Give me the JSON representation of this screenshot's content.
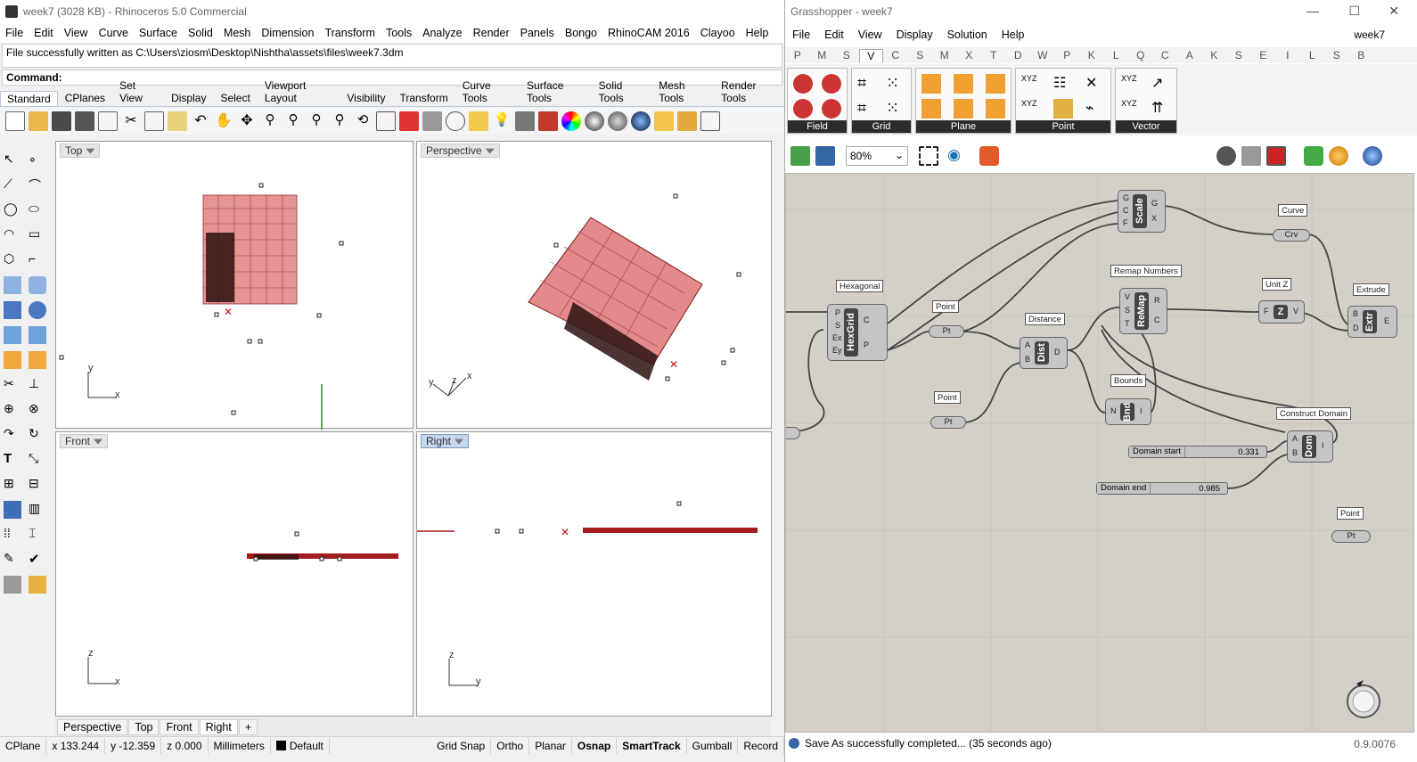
{
  "rhino": {
    "title": "week7 (3028 KB) - Rhinoceros 5.0 Commercial",
    "menu": [
      "File",
      "Edit",
      "View",
      "Curve",
      "Surface",
      "Solid",
      "Mesh",
      "Dimension",
      "Transform",
      "Tools",
      "Analyze",
      "Render",
      "Panels",
      "Bongo",
      "RhinoCAM 2016",
      "Clayoo",
      "Help"
    ],
    "command_history": "File successfully written as C:\\Users\\ziosm\\Desktop\\Nishtha\\assets\\files\\week7.3dm",
    "command_prompt": "Command:",
    "toolbar_tabs": [
      "Standard",
      "CPlanes",
      "Set View",
      "Display",
      "Select",
      "Viewport Layout",
      "Visibility",
      "Transform",
      "Curve Tools",
      "Surface Tools",
      "Solid Tools",
      "Mesh Tools",
      "Render Tools"
    ],
    "viewports": {
      "top": {
        "label": "Top",
        "axis_x": "x",
        "axis_y": "y"
      },
      "perspective": {
        "label": "Perspective",
        "axis_x": "x",
        "axis_y": "y",
        "axis_z": "z"
      },
      "front": {
        "label": "Front",
        "axis_x": "x",
        "axis_y": "z"
      },
      "right": {
        "label": "Right",
        "axis_x": "y",
        "axis_y": "z"
      }
    },
    "viewport_tabs": [
      "Perspective",
      "Top",
      "Front",
      "Right"
    ],
    "add_tab": "+",
    "status": {
      "cplane": "CPlane",
      "x": "x 133.244",
      "y": "y -12.359",
      "z": "z 0.000",
      "units": "Millimeters",
      "layer": "Default",
      "grid_snap": "Grid Snap",
      "ortho": "Ortho",
      "planar": "Planar",
      "osnap": "Osnap",
      "smarttrack": "SmartTrack",
      "gumball": "Gumball",
      "record": "Record"
    }
  },
  "grasshopper": {
    "title": "Grasshopper - week7",
    "menu": [
      "File",
      "Edit",
      "View",
      "Display",
      "Solution",
      "Help"
    ],
    "document": "week7",
    "category_tabs": [
      "P",
      "M",
      "S",
      "V",
      "C",
      "S",
      "M",
      "X",
      "T",
      "D",
      "W",
      "P",
      "K",
      "L",
      "Q",
      "C",
      "A",
      "K",
      "S",
      "E",
      "I",
      "L",
      "S",
      "B"
    ],
    "ribbon_groups": [
      "Field",
      "Grid",
      "Plane",
      "Point",
      "Vector"
    ],
    "zoom": "80%",
    "canvas": {
      "hexgrid": {
        "tag": "Hexagonal",
        "core": "HexGrid",
        "inputs": [
          "P",
          "S",
          "Ex",
          "Ey"
        ],
        "outputs": [
          "C",
          "P"
        ]
      },
      "scale": {
        "core": "Scale",
        "inputs": [
          "G",
          "C",
          "F"
        ],
        "outputs": [
          "G",
          "X"
        ]
      },
      "curve": {
        "tag": "Curve",
        "param": "Crv"
      },
      "point1": {
        "tag": "Point",
        "param": "Pt"
      },
      "point2": {
        "tag": "Point",
        "param": "Pt"
      },
      "point3": {
        "tag": "Point",
        "param": "Pt"
      },
      "distance": {
        "tag": "Distance",
        "core": "Dist",
        "inputs": [
          "A",
          "B"
        ],
        "outputs": [
          "D"
        ]
      },
      "remap": {
        "tag": "Remap Numbers",
        "core": "ReMap",
        "inputs": [
          "V",
          "S",
          "T"
        ],
        "outputs": [
          "R",
          "C"
        ]
      },
      "unitz": {
        "tag": "Unit Z",
        "core": "Z",
        "inputs": [
          "F"
        ],
        "outputs": [
          "V"
        ]
      },
      "extrude": {
        "tag": "Extrude",
        "core": "Extr",
        "inputs": [
          "B",
          "D"
        ],
        "outputs": [
          "E"
        ]
      },
      "bounds": {
        "tag": "Bounds",
        "core": "Bnd",
        "inputs": [
          "N"
        ],
        "outputs": [
          "I"
        ]
      },
      "construct_domain": {
        "tag": "Construct Domain",
        "core": "Dom",
        "inputs": [
          "A",
          "B"
        ],
        "outputs": [
          "I"
        ]
      },
      "slider_start": {
        "label": "Domain start",
        "value": "0.331"
      },
      "slider_end": {
        "label": "Domain end",
        "value": "0.985"
      }
    },
    "status": "Save As successfully completed... (35 seconds ago)",
    "version": "0.9.0076"
  }
}
